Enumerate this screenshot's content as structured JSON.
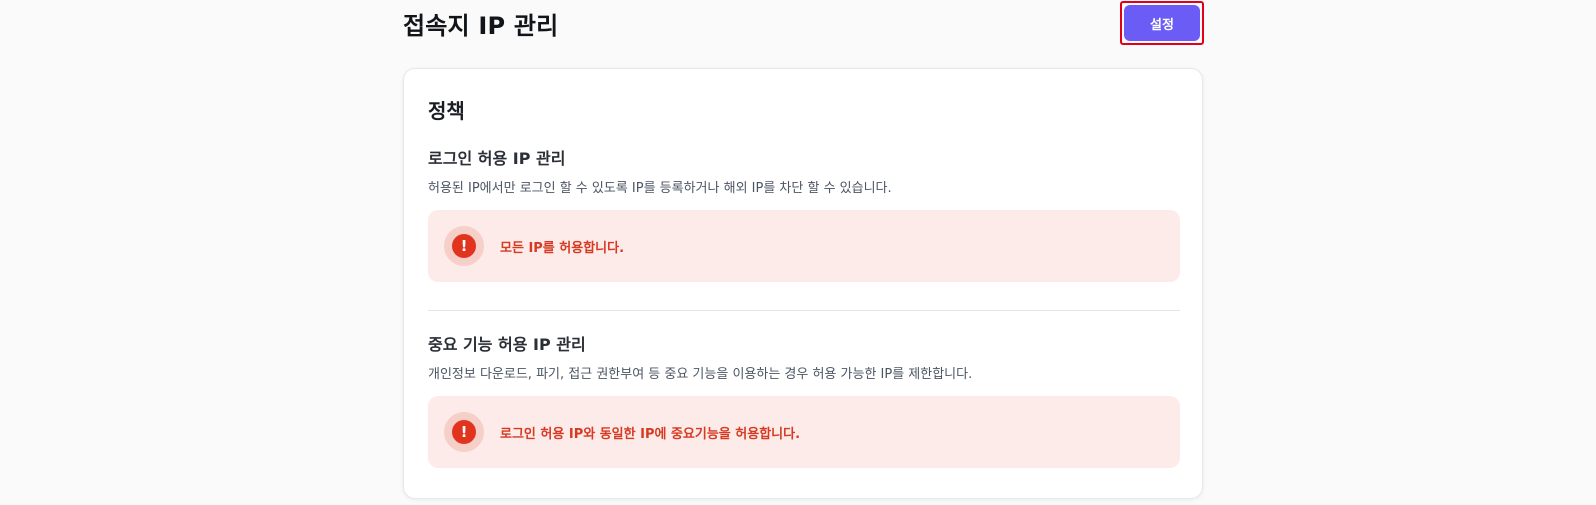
{
  "header": {
    "title": "접속지 IP 관리",
    "settings_label": "설정"
  },
  "policy": {
    "title": "정책",
    "sections": [
      {
        "title": "로그인 허용 IP 관리",
        "description": "허용된 IP에서만 로그인 할 수 있도록 IP를 등록하거나 해외 IP를 차단 할 수 있습니다.",
        "alert": {
          "icon": "exclamation-icon",
          "text": "모든 IP를 허용합니다."
        }
      },
      {
        "title": "중요 기능 허용 IP 관리",
        "description": "개인정보 다운로드, 파기, 접근 권한부여 등 중요 기능을 이용하는 경우 허용 가능한 IP를 제한합니다.",
        "alert": {
          "icon": "exclamation-icon",
          "text": "로그인 허용 IP와 동일한 IP에 중요기능을 허용합니다."
        }
      }
    ]
  },
  "colors": {
    "accent": "#6b5cf6",
    "alert_bg": "#fdebe9",
    "alert_text": "#d63a22",
    "alert_icon": "#e0341e",
    "highlight_border": "#e0001b"
  }
}
